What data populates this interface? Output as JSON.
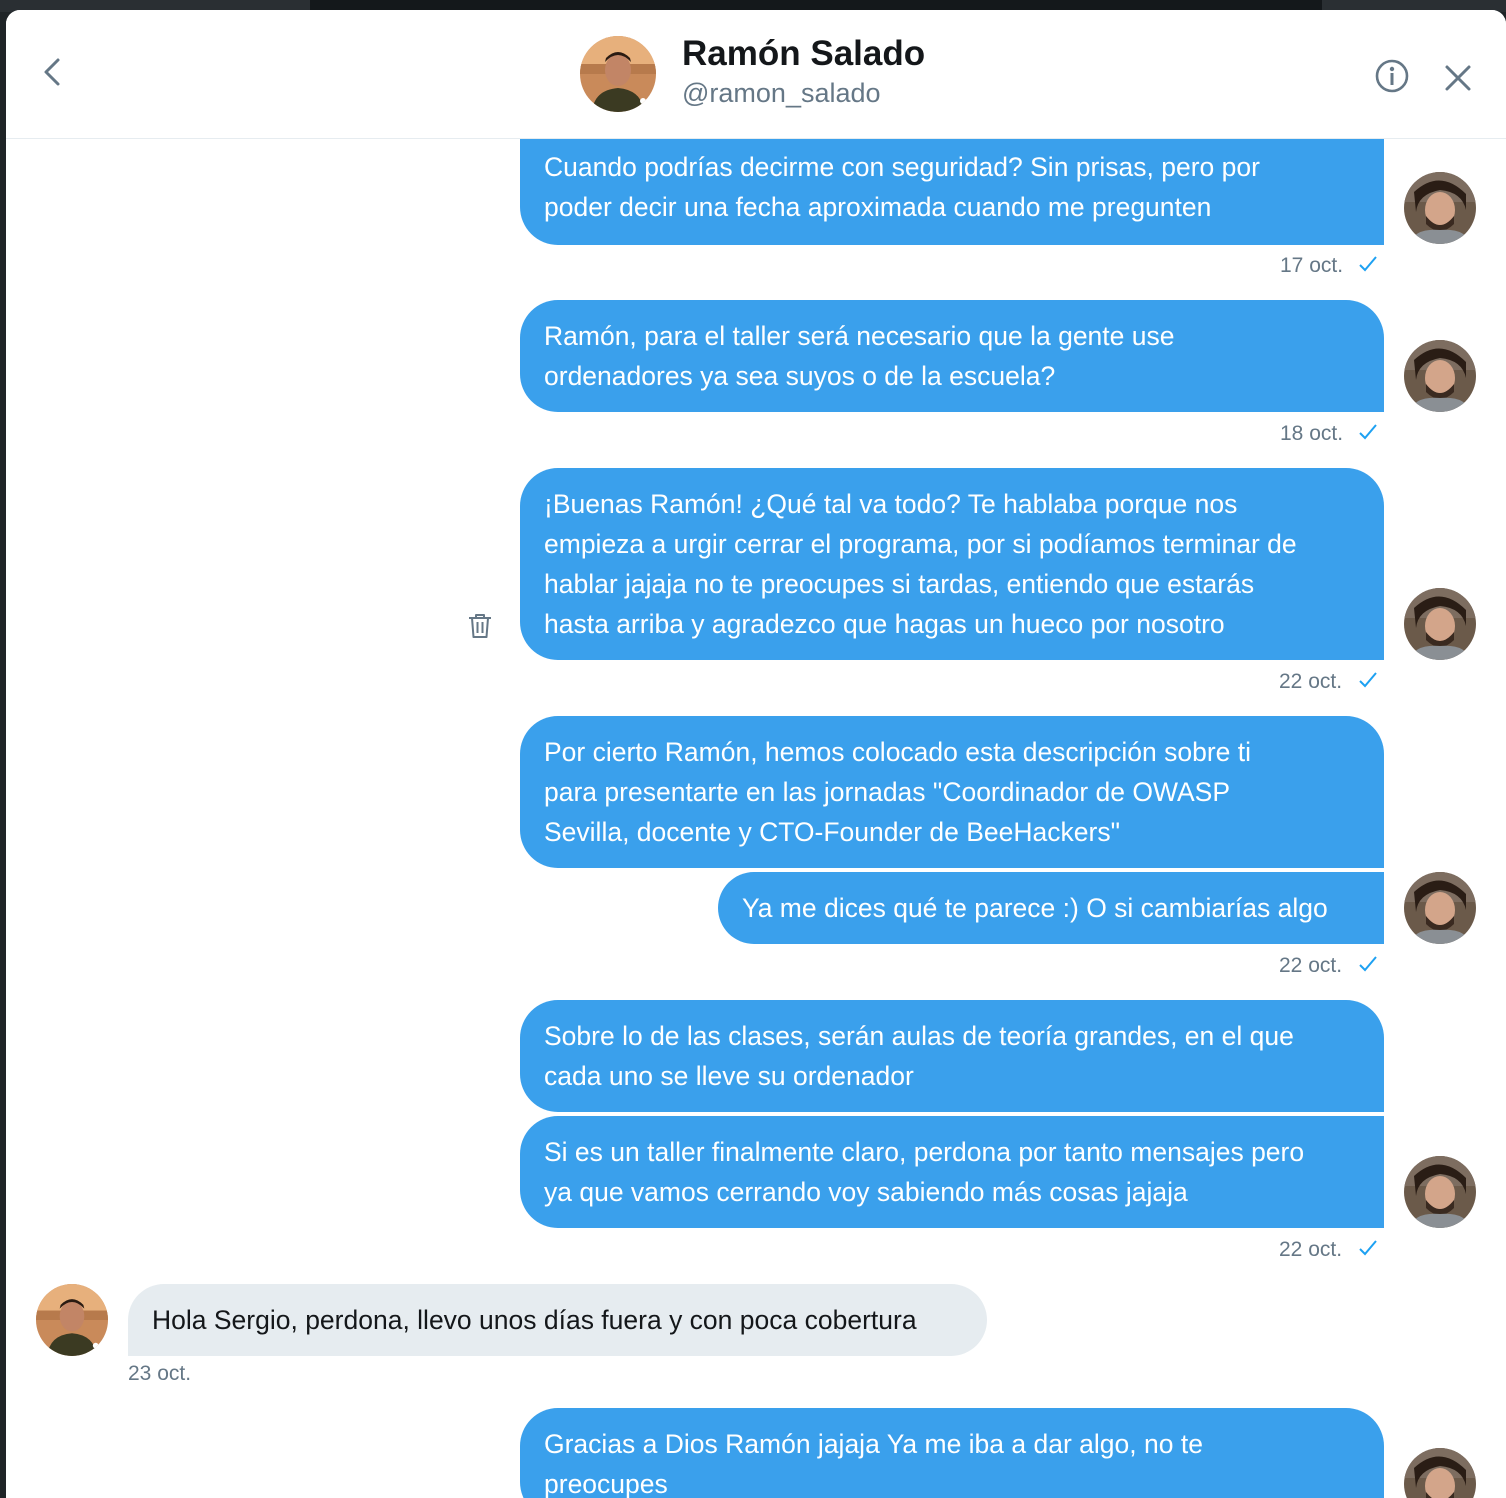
{
  "header": {
    "name": "Ramón Salado",
    "handle": "@ramon_salado"
  },
  "icons": {
    "back": "chevron-left-icon",
    "info": "info-icon",
    "close": "close-icon",
    "delete": "trash-icon",
    "read": "check-icon"
  },
  "colors": {
    "outgoing_bubble": "#3aa0ec",
    "incoming_bubble": "#e6ecf0",
    "meta_text": "#657786",
    "check": "#1da1f2"
  },
  "messages": [
    {
      "text1": "Cuando podrías decirme con seguridad? Sin prisas, pero por",
      "text2": "poder decir una fecha aproximada cuando me pregunten",
      "date": "17 oct."
    },
    {
      "text1": "Ramón, para el taller será necesario que la gente use",
      "text2": "ordenadores ya sea suyos o de la escuela?",
      "date": "18 oct."
    },
    {
      "text1": "¡Buenas Ramón! ¿Qué tal va todo? Te hablaba porque nos",
      "text2": "empieza a urgir cerrar el programa, por si podíamos terminar de",
      "text3": "hablar jajaja no te preocupes si tardas, entiendo que estarás",
      "text4": "hasta arriba y agradezco que hagas un hueco por nosotro",
      "date": "22 oct."
    },
    {
      "text1": "Por cierto Ramón, hemos colocado esta descripción sobre ti",
      "text2": "para presentarte en las jornadas \"Coordinador de OWASP",
      "text3": "Sevilla, docente y CTO-Founder de BeeHackers\""
    },
    {
      "text1": "Ya me dices qué te parece :) O si cambiarías algo",
      "date": "22 oct."
    },
    {
      "text1": "Sobre lo de las clases, serán aulas de teoría grandes, en el que",
      "text2": "cada uno se lleve su ordenador"
    },
    {
      "text1": "Si es un taller finalmente claro, perdona por tanto mensajes pero",
      "text2": "ya que vamos cerrando voy sabiendo más cosas jajaja",
      "date": "22 oct."
    },
    {
      "text1": "Hola Sergio, perdona, llevo unos días fuera y con poca cobertura",
      "date": "23 oct."
    },
    {
      "text1": "Gracias a Dios Ramón jajaja Ya me iba a dar algo, no te",
      "text2": "preocupes"
    }
  ]
}
